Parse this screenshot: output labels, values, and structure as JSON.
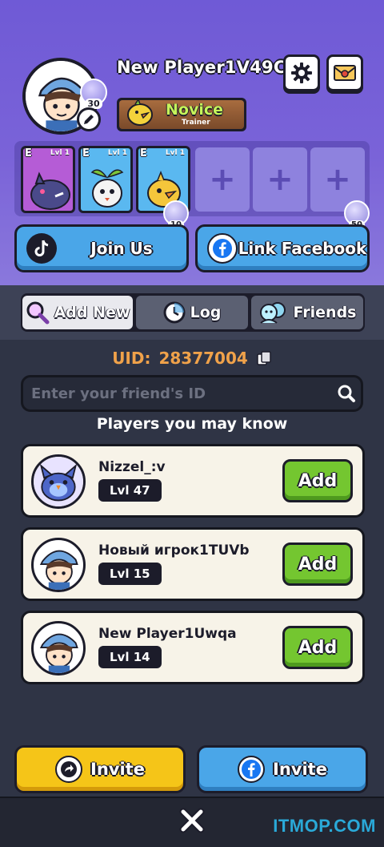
{
  "header": {
    "player_name": "New Player1V49C",
    "level": "30",
    "rank_title": "Novice",
    "rank_subtitle": "Trainer",
    "settings_icon": "gear-icon",
    "mail_icon": "mail-icon"
  },
  "team": [
    {
      "tier": "E",
      "level": "Lvl 1",
      "color": "#b55cd6"
    },
    {
      "tier": "E",
      "level": "Lvl 1",
      "color": "#5ab8f0"
    },
    {
      "tier": "E",
      "level": "Lvl 1",
      "color": "#5ab8f0"
    }
  ],
  "empty_slot_symbol": "+",
  "unlock_costs": [
    "10",
    "50"
  ],
  "social": {
    "join_label": "Join Us",
    "facebook_label": "Link Facebook"
  },
  "tabs": [
    {
      "label": "Add New",
      "icon": "magnifier-icon",
      "active": true
    },
    {
      "label": "Log",
      "icon": "clock-icon",
      "active": false
    },
    {
      "label": "Friends",
      "icon": "friends-icon",
      "active": false
    }
  ],
  "uid": {
    "label": "UID:",
    "value": "28377004"
  },
  "search": {
    "placeholder": "Enter your friend's ID"
  },
  "suggestions_title": "Players you may know",
  "players": [
    {
      "name": "Nizzel_:v",
      "level": "Lvl 47",
      "add_label": "Add"
    },
    {
      "name": "Новый игрок1TUVb",
      "level": "Lvl 15",
      "add_label": "Add"
    },
    {
      "name": "New Player1Uwqa",
      "level": "Lvl 14",
      "add_label": "Add"
    }
  ],
  "invite": {
    "share_label": "Invite",
    "facebook_label": "Invite"
  },
  "colors": {
    "header_purple": "#7a63d8",
    "add_green": "#74c630",
    "uid_orange": "#f0a24a",
    "invite_yellow": "#f5c518",
    "invite_blue": "#4aa6e8"
  },
  "watermark": "ITMOP.COM"
}
